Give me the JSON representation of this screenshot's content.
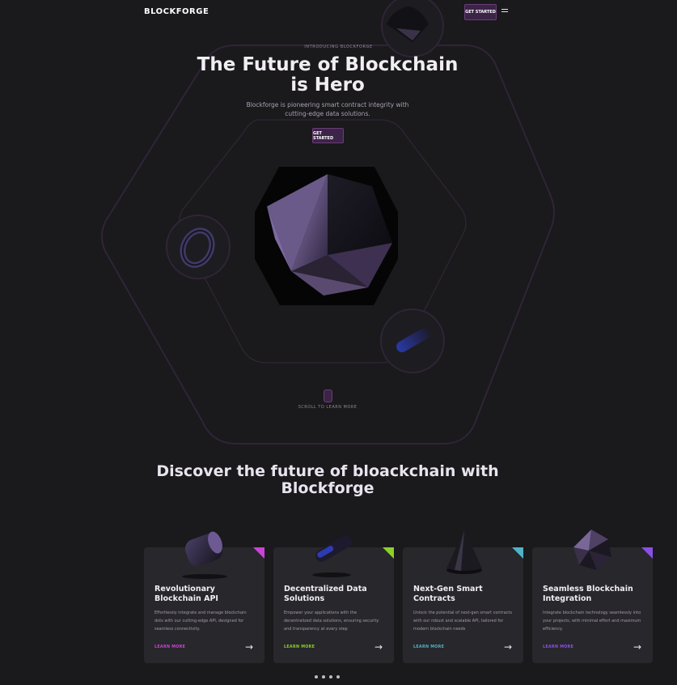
{
  "nav": {
    "logo": "BLOCKFORGE",
    "cta": "GET STARTED"
  },
  "hero": {
    "eyebrow": "INTRODUCING BLOCKFORGE",
    "title": "The Future of Blockchain is Hero",
    "subtitle": "Blockforge is pioneering smart contract integrity with cutting-edge data solutions.",
    "cta": "GET STARTED",
    "scroll_text": "SCROLL TO LEARN MORE"
  },
  "discover": {
    "title": "Discover the future of bloackchain with Blockforge"
  },
  "cards": [
    {
      "title": "Revolutionary Blockchain API",
      "desc": "Effortlessly integrate and manage blockchain dots with our cutting-edge API, designed for seamless connectivity.",
      "link": "LEARN MORE",
      "accent": "#c844d6"
    },
    {
      "title": "Decentralized Data Solutions",
      "desc": "Empower your applications with the decentralized data solutions, ensuring security and transparency at every step",
      "link": "LEARN MORE",
      "accent": "#8ccf2b"
    },
    {
      "title": "Next-Gen Smart Contracts",
      "desc": "Unlock the potential of next-gen smart contracts with our robust and scalable API, tailored for modern blockchain needs",
      "link": "LEARN MORE",
      "accent": "#4fb3c9"
    },
    {
      "title": "Seamless Blockchain Integration",
      "desc": "Integrate blockchain technology seamlessly into your projects, with minimal effort and maximum efficiency.",
      "link": "LEARN MORE",
      "accent": "#8a4fe8"
    }
  ],
  "colors": {
    "background": "#1a191c",
    "card": "#28272b",
    "button": "#3b2447"
  }
}
